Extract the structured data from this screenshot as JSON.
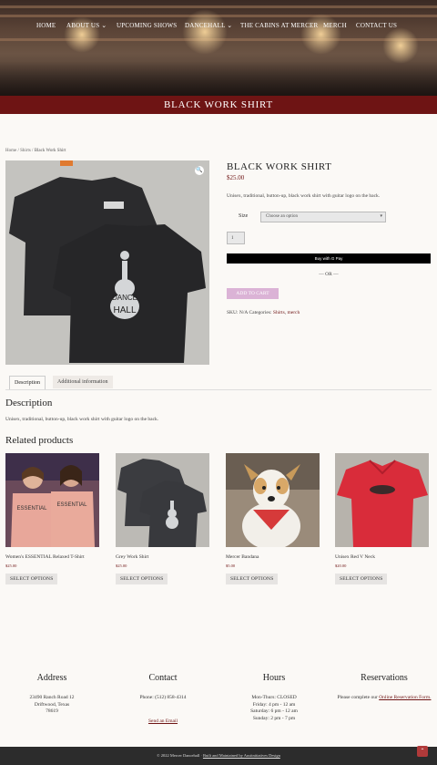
{
  "nav": {
    "items": [
      {
        "label": "HOME"
      },
      {
        "label": "ABOUT US",
        "caret": "⌄"
      },
      {
        "label": "UPCOMING SHOWS"
      },
      {
        "label": "DANCEHALL",
        "caret": "⌄"
      },
      {
        "label": "THE CABINS AT MERCER"
      },
      {
        "label": "MERCH"
      },
      {
        "label": "CONTACT US"
      }
    ]
  },
  "page_title": "BLACK WORK SHIRT",
  "breadcrumb": {
    "home": "Home",
    "sep1": " / ",
    "cat": "Shirts",
    "sep2": " / ",
    "current": "Black Work Shirt"
  },
  "product": {
    "title": "BLACK WORK SHIRT",
    "price": "$25.00",
    "short_desc": "Unisex, traditional, button-up, black work shirt with guitar logo on the back.",
    "size_label": "Size",
    "size_placeholder": "Choose an option",
    "qty": "1",
    "gpay_label": "Buy with G Pay",
    "or_label": "— OR —",
    "add_to_cart": "ADD TO CART",
    "sku_label": "SKU: N/A",
    "categories_label": "Categories:",
    "cat1": "Shirts",
    "cat2": "merch",
    "shirt_logo_line1": "DANCE",
    "shirt_logo_line2": "HALL",
    "zoom_icon": "🔍"
  },
  "tabs": [
    {
      "label": "Description"
    },
    {
      "label": "Additional information"
    }
  ],
  "description": {
    "heading": "Description",
    "text": "Unisex, traditional, button-up, black work shirt with guitar logo on the back."
  },
  "related": {
    "heading": "Related products",
    "items": [
      {
        "name": "Women's ESSENTIAL Relaxed T-Shirt",
        "price": "$25.00",
        "button": "SELECT OPTIONS",
        "shirt_text": "ESSENTIAL"
      },
      {
        "name": "Grey Work Shirt",
        "price": "$25.00",
        "button": "SELECT OPTIONS"
      },
      {
        "name": "Mercer Bandana",
        "price": "$5.00",
        "button": "SELECT OPTIONS"
      },
      {
        "name": "Unisex Red V Neck",
        "price": "$20.00",
        "button": "SELECT OPTIONS"
      }
    ]
  },
  "footer": {
    "address": {
      "heading": "Address",
      "line1": "23490 Ranch Road 12",
      "line2": "Driftwood, Texas",
      "line3": "78619"
    },
    "contact": {
      "heading": "Contact",
      "phone": "Phone: (512) 858-4314",
      "email_link": "Send an Email"
    },
    "hours": {
      "heading": "Hours",
      "line1": "Mon-Thurs: CLOSED",
      "line2": "Friday: 4 pm - 12 am",
      "line3": "Saturday: 6 pm - 12 am",
      "line4": "Sunday: 2 pm - 7 pm"
    },
    "reservations": {
      "heading": "Reservations",
      "text": "Please complete our ",
      "link": "Online Reservation Form."
    },
    "copyright": "© 2022 Mercer Dancehall · ",
    "credit": "Built and Maintained by Austinitiatives Design",
    "top_icon": "⌃"
  },
  "colors": {
    "brand": "#6e1414",
    "cart_button": "#dbb3d6"
  }
}
